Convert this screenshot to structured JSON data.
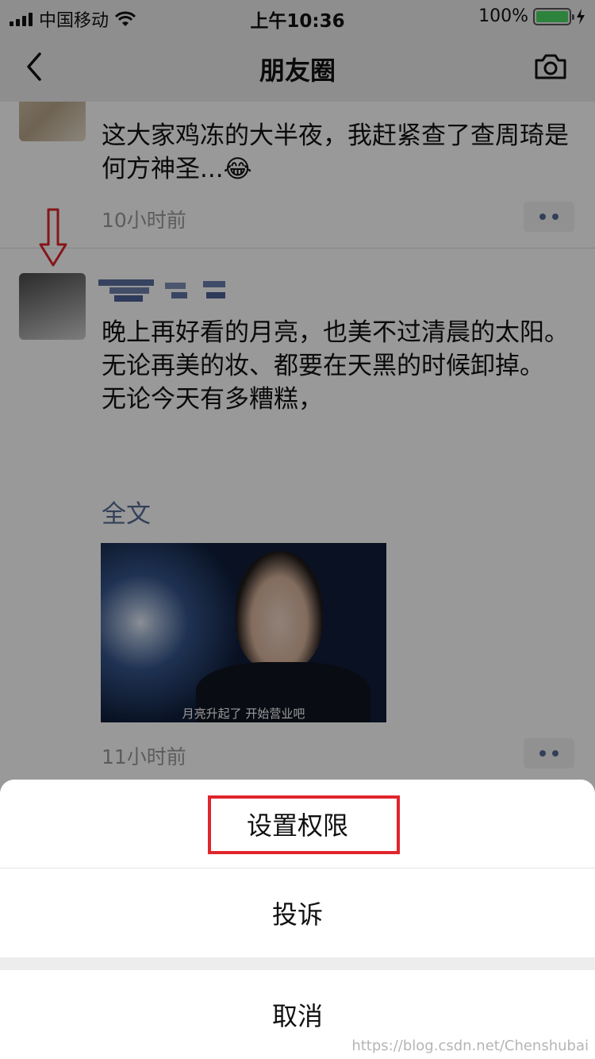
{
  "status_bar": {
    "carrier": "中国移动",
    "time": "上午10:36",
    "battery": "100%",
    "battery_level": 1.0
  },
  "nav": {
    "title": "朋友圈",
    "back_icon": "chevron-left-icon",
    "camera_icon": "camera-icon"
  },
  "posts": [
    {
      "text": "这大家鸡冻的大半夜，我赶紧查了查周琦是何方神圣...😂",
      "time_ago": "10小时前"
    },
    {
      "text_lines": [
        "晚上再好看的月亮，也美不过清晨的太阳。",
        "无论再美的妆、都要在天黑的时候卸掉。",
        "无论今天有多糟糕，"
      ],
      "full_text_link": "全文",
      "image_caption": "月亮升起了 开始营业吧",
      "time_ago": "11小时前"
    }
  ],
  "action_sheet": {
    "set_permission": "设置权限",
    "report": "投诉",
    "cancel": "取消"
  },
  "watermark": "https://blog.csdn.net/Chenshubai",
  "colors": {
    "link": "#576b95",
    "highlight": "#e0252b",
    "nav_bg": "#ededed"
  }
}
